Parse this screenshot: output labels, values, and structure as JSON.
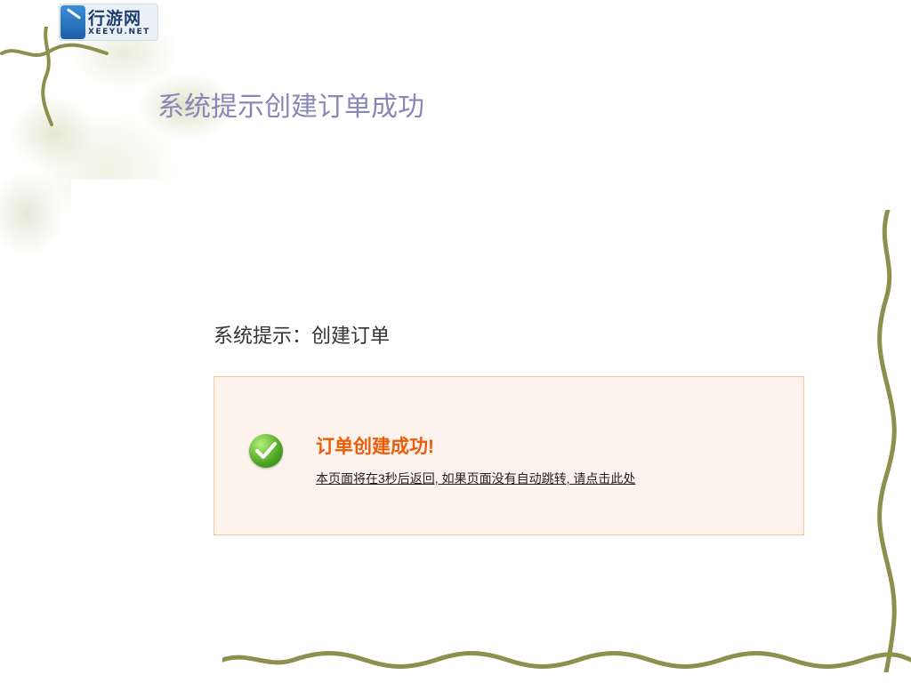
{
  "logo": {
    "name_cn": "行游网",
    "name_en": "XEEYU.NET"
  },
  "slide": {
    "title": "系统提示创建订单成功"
  },
  "system_prompt": {
    "label": "系统提示：创建订单"
  },
  "message_box": {
    "icon": "success-check-icon",
    "success_text": "订单创建成功!",
    "redirect_text": "本页面将在3秒后返回, 如果页面没有自动跳转, 请点击此处"
  },
  "colors": {
    "title": "#8a86b8",
    "success": "#e85c0a",
    "box_bg": "#fdf3ec",
    "box_border": "#f0c7a0",
    "vine": "#8d8f4e"
  }
}
